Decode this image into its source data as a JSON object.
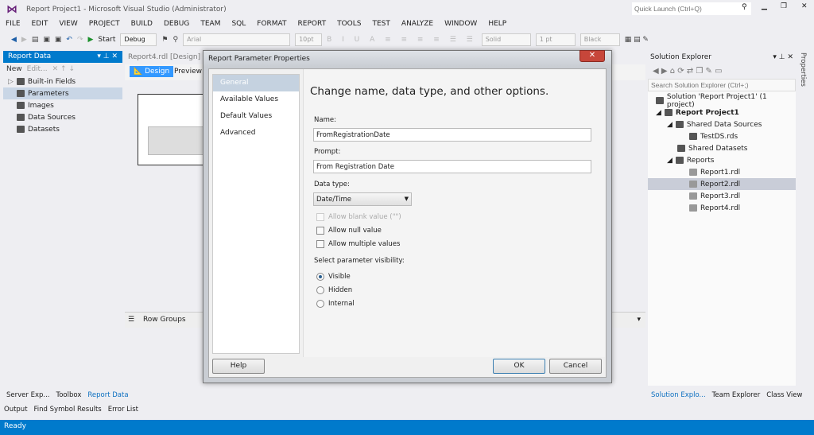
{
  "window": {
    "title": "Report Project1 - Microsoft Visual Studio (Administrator)",
    "quick_launch_placeholder": "Quick Launch (Ctrl+Q)"
  },
  "menu": [
    "FILE",
    "EDIT",
    "VIEW",
    "PROJECT",
    "BUILD",
    "DEBUG",
    "TEAM",
    "SQL",
    "FORMAT",
    "REPORT",
    "TOOLS",
    "TEST",
    "ANALYZE",
    "WINDOW",
    "HELP"
  ],
  "toolbar": {
    "start": "Start",
    "config": "Debug",
    "font": "Arial",
    "size": "10pt",
    "line_style": "Solid",
    "line_width": "1 pt",
    "color": "Black"
  },
  "report_data": {
    "title": "Report Data",
    "new": "New",
    "edit": "Edit...",
    "items": [
      "Built-in Fields",
      "Parameters",
      "Images",
      "Data Sources",
      "Datasets"
    ]
  },
  "document": {
    "tab": "Report4.rdl [Design]",
    "design": "Design",
    "preview": "Preview",
    "row_groups": "Row Groups"
  },
  "dialog": {
    "title": "Report Parameter Properties",
    "nav": [
      "General",
      "Available Values",
      "Default Values",
      "Advanced"
    ],
    "heading": "Change name, data type, and other options.",
    "name_label": "Name:",
    "name_value": "FromRegistrationDate",
    "prompt_label": "Prompt:",
    "prompt_value": "From Registration Date",
    "datatype_label": "Data type:",
    "datatype_value": "Date/Time",
    "checks": [
      "Allow blank value (\"\")",
      "Allow null value",
      "Allow multiple values"
    ],
    "visibility_label": "Select parameter visibility:",
    "radios": [
      "Visible",
      "Hidden",
      "Internal"
    ],
    "help": "Help",
    "ok": "OK",
    "cancel": "Cancel"
  },
  "solution_explorer": {
    "title": "Solution Explorer",
    "search_placeholder": "Search Solution Explorer (Ctrl+;)",
    "solution": "Solution 'Report Project1' (1 project)",
    "project": "Report Project1",
    "shared_data_sources": "Shared Data Sources",
    "testds": "TestDS.rds",
    "shared_datasets": "Shared Datasets",
    "reports": "Reports",
    "report_files": [
      "Report1.rdl",
      "Report2.rdl",
      "Report3.rdl",
      "Report4.rdl"
    ],
    "properties_tab": "Properties"
  },
  "left_tabs": [
    "Server Exp...",
    "Toolbox",
    "Report Data"
  ],
  "right_tabs": [
    "Solution Explo...",
    "Team Explorer",
    "Class View"
  ],
  "bottom_tabs": [
    "Output",
    "Find Symbol Results",
    "Error List"
  ],
  "status": "Ready"
}
